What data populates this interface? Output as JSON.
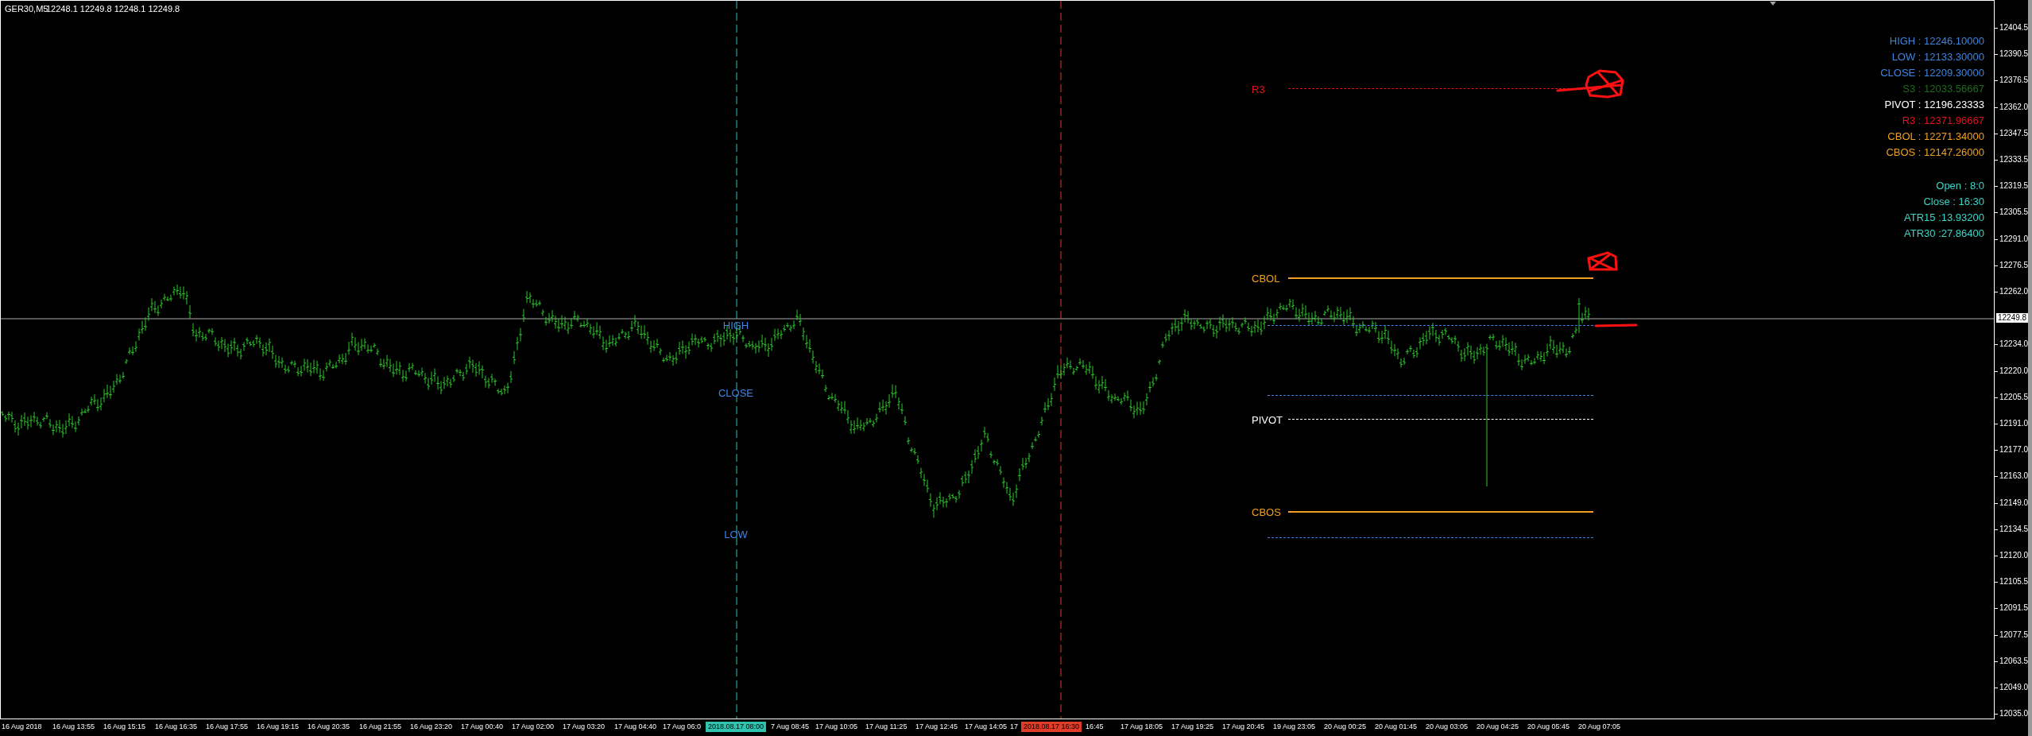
{
  "title_bar": {
    "symbol": "GER30,M5",
    "quote": "12248.1 12249.8 12248.1 12249.8"
  },
  "info_panel": [
    [
      {
        "text": "HIGH : 12246.10000",
        "color": "#3d85e0"
      },
      {
        "text": "LOW : 12133.30000",
        "color": "#3d85e0"
      },
      {
        "text": "CLOSE : 12209.30000",
        "color": "#3d85e0"
      },
      {
        "text": "S3 : 12033.56667",
        "color": "#1e6b1e"
      },
      {
        "text": "PIVOT : 12196.23333",
        "color": "#ffffff"
      },
      {
        "text": "R3 : 12371.96667",
        "color": "#e0141e"
      },
      {
        "text": "CBOL : 12271.34000",
        "color": "#eea020"
      },
      {
        "text": "CBOS : 12147.26000",
        "color": "#eea020"
      }
    ],
    [
      {
        "text": "Open : 8:0",
        "color": "#3ad6c8"
      },
      {
        "text": "Close : 16:30",
        "color": "#3ad6c8"
      },
      {
        "text": "ATR15 :13.93200",
        "color": "#3ad6c8"
      },
      {
        "text": "ATR30 :27.86400",
        "color": "#3ad6c8"
      }
    ]
  ],
  "levels": [
    {
      "label": "R3",
      "color": "#e0141e",
      "kind": "dashed"
    },
    {
      "label": "CBOL",
      "color": "#f0a020",
      "kind": "solid"
    },
    {
      "color": "#3d85e0",
      "kind": "dashed"
    },
    {
      "color": "#3d85e0",
      "kind": "dashed"
    },
    {
      "label": "PIVOT",
      "color": "#ffffff",
      "kind": "dashed"
    },
    {
      "label": "CBOS",
      "color": "#f0a020",
      "kind": "solid"
    },
    {
      "color": "#3d85e0",
      "kind": "dashed"
    }
  ],
  "session_labels": [
    "HIGH",
    "CLOSE",
    "LOW"
  ],
  "vertical_lines": [
    {
      "color": "#2ec4b0",
      "time_label": "2018.08.17 08:00"
    },
    {
      "color": "#e03c28",
      "time_label": "2018.08.17 16:30"
    }
  ],
  "price_axis": {
    "labels": [
      "12404.5",
      "12390.5",
      "12376.5",
      "12362.0",
      "12347.5",
      "12333.5",
      "12319.5",
      "12305.5",
      "12291.0",
      "12276.5",
      "12262.0",
      "12234.0",
      "12220.0",
      "12205.5",
      "12191.0",
      "12177.0",
      "12163.0",
      "12149.0",
      "12134.5",
      "12120.0",
      "12105.5",
      "12091.5",
      "12077.5",
      "12063.5",
      "12049.0",
      "12035.0"
    ],
    "current": "12249.8"
  },
  "time_axis": [
    "16 Aug 2018",
    "16 Aug 13:55",
    "16 Aug 15:15",
    "16 Aug 16:35",
    "16 Aug 17:55",
    "16 Aug 19:15",
    "16 Aug 20:35",
    "16 Aug 21:55",
    "16 Aug 23:20",
    "17 Aug 00:40",
    "17 Aug 02:00",
    "17 Aug 03:20",
    "17 Aug 04:40",
    "17 Aug 06:0",
    "7 Aug 08:45",
    "17 Aug 10:05",
    "17 Aug 11:25",
    "17 Aug 12:45",
    "17 Aug 14:05",
    "17",
    "16:45",
    "17 Aug 18:05",
    "17 Aug 19:25",
    "17 Aug 20:45",
    "19 Aug 23:05",
    "20 Aug 00:25",
    "20 Aug 01:45",
    "20 Aug 03:05",
    "20 Aug 04:25",
    "20 Aug 05:45",
    "20 Aug 07:05"
  ]
}
